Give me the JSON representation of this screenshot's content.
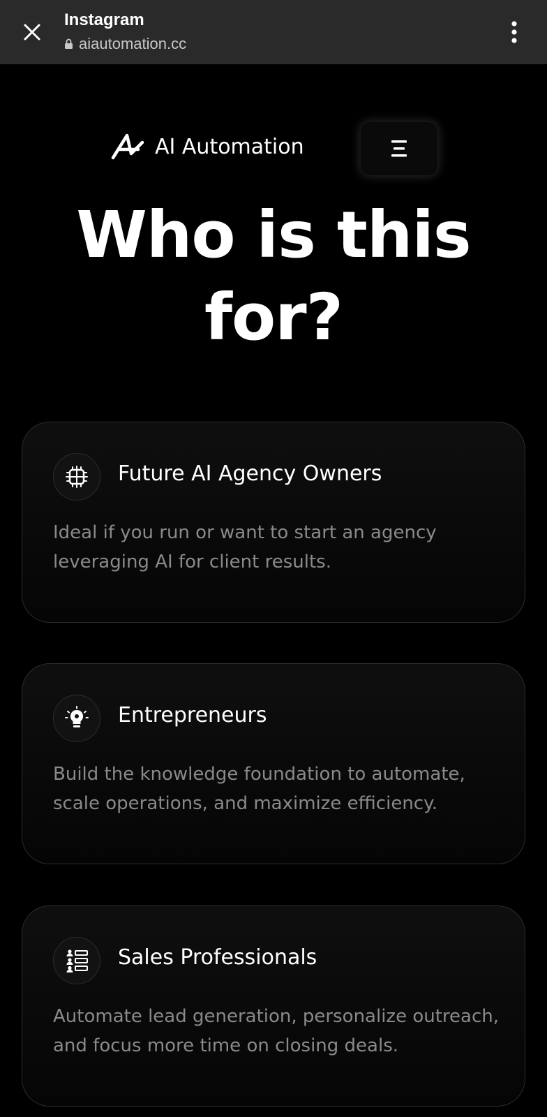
{
  "browser": {
    "title": "Instagram",
    "url": "aiautomation.cc",
    "icons": {
      "close": "close-icon",
      "lock": "lock-icon",
      "menu": "more-vertical-icon"
    }
  },
  "header": {
    "logo_text": "AI Automation",
    "logo_icon": "ai-automation-logo",
    "menu_icon": "hamburger-menu-icon"
  },
  "hero": {
    "title_line1": "Who is this",
    "title_line2": "for?"
  },
  "cards": [
    {
      "icon": "brain-chip-icon",
      "title": "Future AI Agency Owners",
      "desc_line1": "Ideal if you run or want to start an agency",
      "desc_line2": "leveraging AI for client results."
    },
    {
      "icon": "lightbulb-gear-icon",
      "title": "Entrepreneurs",
      "desc_line1": "Build the knowledge foundation to automate,",
      "desc_line2": "scale operations, and maximize efficiency."
    },
    {
      "icon": "people-list-icon",
      "title": "Sales Professionals",
      "desc_line1": "Automate lead generation, personalize outreach,",
      "desc_line2": "and focus more time on closing deals."
    }
  ],
  "colors": {
    "background": "#000000",
    "browser_bar": "#2a2a2a",
    "card_border": "#2c2c2c",
    "text_primary": "#ffffff",
    "text_muted": "#8a8a8a"
  }
}
